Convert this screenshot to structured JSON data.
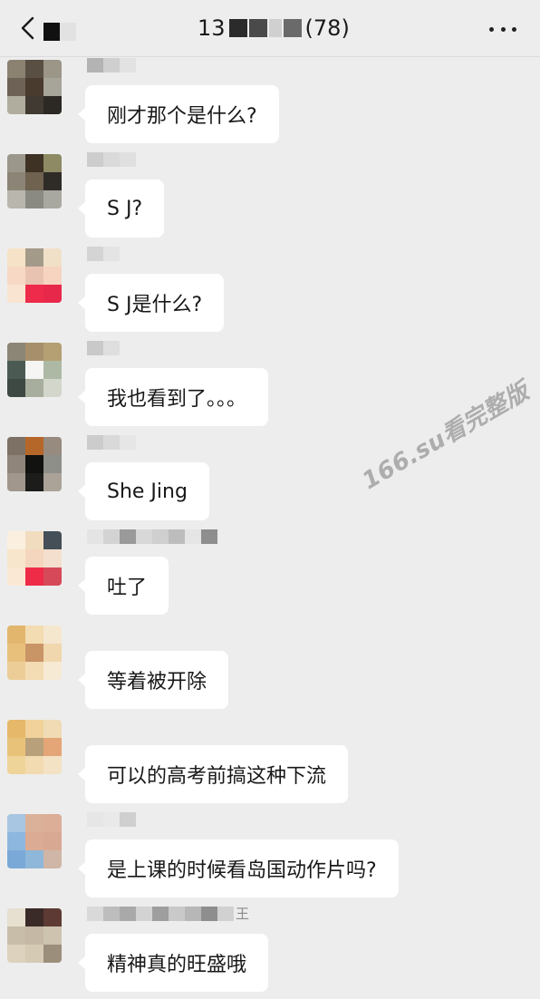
{
  "header": {
    "title_prefix": "13",
    "title_count": "(78)"
  },
  "messages": [
    {
      "text": "刚才那个是什么?",
      "sender": [
        "#b3b3b3",
        "#cfcfcf",
        "#e2e2e2"
      ],
      "avatar": [
        "#8b8272",
        "#5a4f43",
        "#9b9688",
        "#6e6155",
        "#4a3b2f",
        "#a7a49a",
        "#b0ad9f",
        "#403a33",
        "#2c2823"
      ]
    },
    {
      "text": "S J?",
      "sender": [
        "#cdcdcd",
        "#dadada",
        "#e0e0e0"
      ],
      "avatar": [
        "#9c978b",
        "#3e3224",
        "#8e8a64",
        "#8c8476",
        "#6f624f",
        "#2f2b27",
        "#b9b6ad",
        "#8a8a82",
        "#a8a8a1"
      ]
    },
    {
      "text": "S J是什么?",
      "sender": [
        "#d4d4d4",
        "#e4e4e4"
      ],
      "avatar": [
        "#f6e2c6",
        "#a49a8a",
        "#f1e0c8",
        "#f7d8c5",
        "#e9c3b2",
        "#f6d4c0",
        "#f8e4d0",
        "#ee2b4a",
        "#e8284a"
      ]
    },
    {
      "text": "我也看到了。。。",
      "sender": [
        "#c9c9c9",
        "#dedede"
      ],
      "avatar": [
        "#8c8676",
        "#a88f6b",
        "#b4a072",
        "#4b5b54",
        "#f5f5f3",
        "#adb9a4",
        "#3f4943",
        "#a8ae9d",
        "#d2d6cb"
      ]
    },
    {
      "text": "She Jing",
      "sender": [
        "#cccccc",
        "#d9d9d9",
        "#e6e6e6"
      ],
      "avatar": [
        "#7d7166",
        "#b5672a",
        "#978a7e",
        "#90857a",
        "#121210",
        "#8f8f8a",
        "#a1978d",
        "#1c1c1a",
        "#aba398"
      ]
    },
    {
      "text": "吐了",
      "sender": [
        "#e4e4e4",
        "#d3d3d3",
        "#9a9a9a",
        "#d8d8d8",
        "#cfcfcf",
        "#bdbdbd",
        "#e5e5e5",
        "#8e8e8e"
      ],
      "avatar": [
        "#fbf0df",
        "#f2dcc0",
        "#454f58",
        "#f8e6cc",
        "#f3d6bd",
        "#f4dfce",
        "#fbe8d4",
        "#ef2c48",
        "#d64958"
      ]
    },
    {
      "text": "等着被开除",
      "sender": [],
      "avatar": [
        "#e3b66e",
        "#f3dcb2",
        "#f5e6ce",
        "#e8c07c",
        "#c99466",
        "#f1d7ad",
        "#eccd98",
        "#f3dcb4",
        "#f7ead4"
      ]
    },
    {
      "text": "可以的高考前搞这种下流",
      "sender": [],
      "avatar": [
        "#e6b86a",
        "#f0d29a",
        "#f0dbb5",
        "#e9c27a",
        "#b8a07a",
        "#e4a676",
        "#efd49a",
        "#f2dbb0",
        "#f3e2c4"
      ]
    },
    {
      "text": "是上课的时候看岛国动作片吗?",
      "sender": [
        "#e6e6e6",
        "#e9e9e9",
        "#cfcfcf"
      ],
      "avatar": [
        "#a8c6e2",
        "#dcb199",
        "#dcae97",
        "#8db7de",
        "#dbab94",
        "#d9a892",
        "#7aa9d8",
        "#8fb7d9",
        "#cfb6a6"
      ]
    },
    {
      "text": "精神真的旺盛哦",
      "sender": [
        "#d9d9d9",
        "#bdbdbd",
        "#a9a9a9",
        "#d3d3d3",
        "#9e9e9e",
        "#c9c9c9",
        "#b7b7b7",
        "#8e8e8e",
        "#d1d1d1"
      ],
      "sender_tail": "王",
      "avatar": [
        "#e7dfcf",
        "#3a2a28",
        "#5d3b34",
        "#c7bda9",
        "#c5b8a4",
        "#cdc3af",
        "#dcd2bd",
        "#d5cab4",
        "#9b8e7b"
      ]
    }
  ],
  "watermark": "166.su看完整版"
}
